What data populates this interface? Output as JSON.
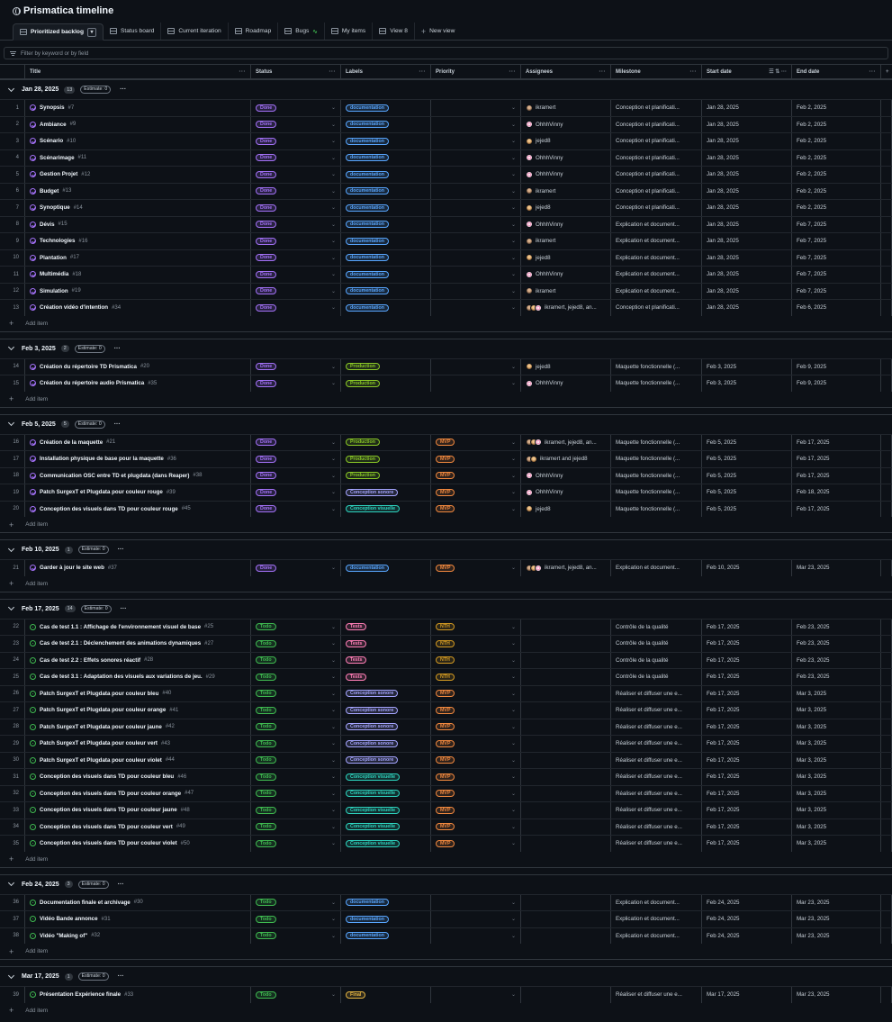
{
  "project": {
    "title": "Prismatica timeline"
  },
  "tabs": [
    {
      "label": "Prioritized backlog",
      "active": true
    },
    {
      "label": "Status board"
    },
    {
      "label": "Current iteration"
    },
    {
      "label": "Roadmap"
    },
    {
      "label": "Bugs"
    },
    {
      "label": "My items"
    },
    {
      "label": "View 8"
    },
    {
      "label": "New view"
    }
  ],
  "filter": {
    "placeholder": "Filter by keyword or by field"
  },
  "columns": [
    "Title",
    "Status",
    "Labels",
    "Priority",
    "Assignees",
    "Milestone",
    "Start date",
    "End date"
  ],
  "add_item_label": "Add item",
  "label_colors": {
    "documentation": "#58a6ff",
    "Production": "#8ac926",
    "Conception sonore": "#a5a5ff",
    "Conception visuelle": "#2dd4bf",
    "Tests": "#ff7eb6",
    "Final": "#e3b341"
  },
  "priority_colors": {
    "MVP": "#f0883e",
    "NTH": "#d29922"
  },
  "status_colors": {
    "Done": "#a371f7",
    "Todo": "#3fb950"
  },
  "groups": [
    {
      "title": "Jan 28, 2025",
      "count": "13",
      "estimate": "Estimate: 0",
      "rows": [
        {
          "n": "1",
          "title": "Synopsis",
          "num": "#7",
          "status": "Done",
          "label": "documentation",
          "priority": "",
          "av": [
            "k"
          ],
          "assignee": "ikramert",
          "milestone": "Conception et planificati...",
          "start": "Jan 28, 2025",
          "end": "Feb 2, 2025"
        },
        {
          "n": "2",
          "title": "Ambiance",
          "num": "#9",
          "status": "Done",
          "label": "documentation",
          "priority": "",
          "av": [
            "o"
          ],
          "assignee": "OhhhVinny",
          "milestone": "Conception et planificati...",
          "start": "Jan 28, 2025",
          "end": "Feb 2, 2025"
        },
        {
          "n": "3",
          "title": "Scénario",
          "num": "#10",
          "status": "Done",
          "label": "documentation",
          "priority": "",
          "av": [
            "j"
          ],
          "assignee": "jejed8",
          "milestone": "Conception et planificati...",
          "start": "Jan 28, 2025",
          "end": "Feb 2, 2025"
        },
        {
          "n": "4",
          "title": "Scénarimage",
          "num": "#11",
          "status": "Done",
          "label": "documentation",
          "priority": "",
          "av": [
            "o"
          ],
          "assignee": "OhhhVinny",
          "milestone": "Conception et planificati...",
          "start": "Jan 28, 2025",
          "end": "Feb 2, 2025"
        },
        {
          "n": "5",
          "title": "Gestion Projet",
          "num": "#12",
          "status": "Done",
          "label": "documentation",
          "priority": "",
          "av": [
            "o"
          ],
          "assignee": "OhhhVinny",
          "milestone": "Conception et planificati...",
          "start": "Jan 28, 2025",
          "end": "Feb 2, 2025"
        },
        {
          "n": "6",
          "title": "Budget",
          "num": "#13",
          "status": "Done",
          "label": "documentation",
          "priority": "",
          "av": [
            "k"
          ],
          "assignee": "ikramert",
          "milestone": "Conception et planificati...",
          "start": "Jan 28, 2025",
          "end": "Feb 2, 2025"
        },
        {
          "n": "7",
          "title": "Synoptique",
          "num": "#14",
          "status": "Done",
          "label": "documentation",
          "priority": "",
          "av": [
            "j"
          ],
          "assignee": "jejed8",
          "milestone": "Conception et planificati...",
          "start": "Jan 28, 2025",
          "end": "Feb 2, 2025"
        },
        {
          "n": "8",
          "title": "Dévis",
          "num": "#15",
          "status": "Done",
          "label": "documentation",
          "priority": "",
          "av": [
            "o"
          ],
          "assignee": "OhhhVinny",
          "milestone": "Explication et document...",
          "start": "Jan 28, 2025",
          "end": "Feb 7, 2025"
        },
        {
          "n": "9",
          "title": "Technologies",
          "num": "#16",
          "status": "Done",
          "label": "documentation",
          "priority": "",
          "av": [
            "k"
          ],
          "assignee": "ikramert",
          "milestone": "Explication et document...",
          "start": "Jan 28, 2025",
          "end": "Feb 7, 2025"
        },
        {
          "n": "10",
          "title": "Plantation",
          "num": "#17",
          "status": "Done",
          "label": "documentation",
          "priority": "",
          "av": [
            "j"
          ],
          "assignee": "jejed8",
          "milestone": "Explication et document...",
          "start": "Jan 28, 2025",
          "end": "Feb 7, 2025"
        },
        {
          "n": "11",
          "title": "Multimédia",
          "num": "#18",
          "status": "Done",
          "label": "documentation",
          "priority": "",
          "av": [
            "o"
          ],
          "assignee": "OhhhVinny",
          "milestone": "Explication et document...",
          "start": "Jan 28, 2025",
          "end": "Feb 7, 2025"
        },
        {
          "n": "12",
          "title": "Simulation",
          "num": "#19",
          "status": "Done",
          "label": "documentation",
          "priority": "",
          "av": [
            "k"
          ],
          "assignee": "ikramert",
          "milestone": "Explication et document...",
          "start": "Jan 28, 2025",
          "end": "Feb 7, 2025"
        },
        {
          "n": "13",
          "title": "Création vidéo d'intention",
          "num": "#34",
          "status": "Done",
          "label": "documentation",
          "priority": "",
          "av": [
            "k",
            "j",
            "o"
          ],
          "assignee": "ikramert, jejed8, an...",
          "milestone": "Conception et planificati...",
          "start": "Jan 28, 2025",
          "end": "Feb 6, 2025"
        }
      ]
    },
    {
      "title": "Feb 3, 2025",
      "count": "2",
      "estimate": "Estimate: 0",
      "rows": [
        {
          "n": "14",
          "title": "Création du répertoire TD Prismatica",
          "num": "#20",
          "status": "Done",
          "label": "Production",
          "priority": "",
          "av": [
            "j"
          ],
          "assignee": "jejed8",
          "milestone": "Maquette fonctionnelle (...",
          "start": "Feb 3, 2025",
          "end": "Feb 9, 2025"
        },
        {
          "n": "15",
          "title": "Création du répertoire audio Prismatica",
          "num": "#35",
          "status": "Done",
          "label": "Production",
          "priority": "",
          "av": [
            "o"
          ],
          "assignee": "OhhhVinny",
          "milestone": "Maquette fonctionnelle (...",
          "start": "Feb 3, 2025",
          "end": "Feb 9, 2025"
        }
      ]
    },
    {
      "title": "Feb 5, 2025",
      "count": "5",
      "estimate": "Estimate: 0",
      "rows": [
        {
          "n": "16",
          "title": "Création de la maquette",
          "num": "#21",
          "status": "Done",
          "label": "Production",
          "priority": "MVP",
          "av": [
            "k",
            "j",
            "o"
          ],
          "assignee": "ikramert, jejed8, an...",
          "milestone": "Maquette fonctionnelle (...",
          "start": "Feb 5, 2025",
          "end": "Feb 17, 2025"
        },
        {
          "n": "17",
          "title": "Installation physique de base pour la maquette",
          "num": "#36",
          "status": "Done",
          "label": "Production",
          "priority": "MVP",
          "av": [
            "k",
            "j"
          ],
          "assignee": "ikramert and jejed8",
          "milestone": "Maquette fonctionnelle (...",
          "start": "Feb 5, 2025",
          "end": "Feb 17, 2025"
        },
        {
          "n": "18",
          "title": "Communication OSC entre TD et plugdata (dans Reaper)",
          "num": "#38",
          "status": "Done",
          "label": "Production",
          "priority": "MVP",
          "av": [
            "o"
          ],
          "assignee": "OhhhVinny",
          "milestone": "Maquette fonctionnelle (...",
          "start": "Feb 5, 2025",
          "end": "Feb 17, 2025"
        },
        {
          "n": "19",
          "title": "Patch SurgexT et Plugdata pour couleur rouge",
          "num": "#39",
          "status": "Done",
          "label": "Conception sonore",
          "priority": "MVP",
          "av": [
            "o"
          ],
          "assignee": "OhhhVinny",
          "milestone": "Maquette fonctionnelle (...",
          "start": "Feb 5, 2025",
          "end": "Feb 18, 2025"
        },
        {
          "n": "20",
          "title": "Conception des visuels dans TD pour couleur rouge",
          "num": "#45",
          "status": "Done",
          "label": "Conception visuelle",
          "priority": "MVP",
          "av": [
            "j"
          ],
          "assignee": "jejed8",
          "milestone": "Maquette fonctionnelle (...",
          "start": "Feb 5, 2025",
          "end": "Feb 17, 2025"
        }
      ]
    },
    {
      "title": "Feb 10, 2025",
      "count": "1",
      "estimate": "Estimate: 0",
      "rows": [
        {
          "n": "21",
          "title": "Garder à jour le site web",
          "num": "#37",
          "status": "Done",
          "label": "documentation",
          "priority": "MVP",
          "av": [
            "k",
            "j",
            "o"
          ],
          "assignee": "ikramert, jejed8, an...",
          "milestone": "Explication et document...",
          "start": "Feb 10, 2025",
          "end": "Mar 23, 2025"
        }
      ]
    },
    {
      "title": "Feb 17, 2025",
      "count": "14",
      "estimate": "Estimate: 0",
      "rows": [
        {
          "n": "22",
          "title": "Cas de test 1.1 : Affichage de l'environnement visuel de base",
          "num": "#25",
          "status": "Todo",
          "label": "Tests",
          "priority": "NTH",
          "av": [],
          "assignee": "",
          "milestone": "Contrôle de la qualité",
          "start": "Feb 17, 2025",
          "end": "Feb 23, 2025"
        },
        {
          "n": "23",
          "title": "Cas de test 2.1 : Déclenchement des animations dynamiques",
          "num": "#27",
          "status": "Todo",
          "label": "Tests",
          "priority": "NTH",
          "av": [],
          "assignee": "",
          "milestone": "Contrôle de la qualité",
          "start": "Feb 17, 2025",
          "end": "Feb 23, 2025"
        },
        {
          "n": "24",
          "title": "Cas de test 2.2 : Effets sonores réactif",
          "num": "#28",
          "status": "Todo",
          "label": "Tests",
          "priority": "NTH",
          "av": [],
          "assignee": "",
          "milestone": "Contrôle de la qualité",
          "start": "Feb 17, 2025",
          "end": "Feb 23, 2025"
        },
        {
          "n": "25",
          "title": "Cas de test 3.1 : Adaptation des visuels aux variations de jeu.",
          "num": "#29",
          "status": "Todo",
          "label": "Tests",
          "priority": "NTH",
          "av": [],
          "assignee": "",
          "milestone": "Contrôle de la qualité",
          "start": "Feb 17, 2025",
          "end": "Feb 23, 2025"
        },
        {
          "n": "26",
          "title": "Patch SurgexT et Plugdata pour couleur bleu",
          "num": "#40",
          "status": "Todo",
          "label": "Conception sonore",
          "priority": "MVP",
          "av": [],
          "assignee": "",
          "milestone": "Réaliser et diffuser une e...",
          "start": "Feb 17, 2025",
          "end": "Mar 3, 2025"
        },
        {
          "n": "27",
          "title": "Patch SurgexT et Plugdata pour couleur orange",
          "num": "#41",
          "status": "Todo",
          "label": "Conception sonore",
          "priority": "MVP",
          "av": [],
          "assignee": "",
          "milestone": "Réaliser et diffuser une e...",
          "start": "Feb 17, 2025",
          "end": "Mar 3, 2025"
        },
        {
          "n": "28",
          "title": "Patch SurgexT et Plugdata pour couleur jaune",
          "num": "#42",
          "status": "Todo",
          "label": "Conception sonore",
          "priority": "MVP",
          "av": [],
          "assignee": "",
          "milestone": "Réaliser et diffuser une e...",
          "start": "Feb 17, 2025",
          "end": "Mar 3, 2025"
        },
        {
          "n": "29",
          "title": "Patch SurgexT et Plugdata pour couleur vert",
          "num": "#43",
          "status": "Todo",
          "label": "Conception sonore",
          "priority": "MVP",
          "av": [],
          "assignee": "",
          "milestone": "Réaliser et diffuser une e...",
          "start": "Feb 17, 2025",
          "end": "Mar 3, 2025"
        },
        {
          "n": "30",
          "title": "Patch SurgexT et Plugdata pour couleur violet",
          "num": "#44",
          "status": "Todo",
          "label": "Conception sonore",
          "priority": "MVP",
          "av": [],
          "assignee": "",
          "milestone": "Réaliser et diffuser une e...",
          "start": "Feb 17, 2025",
          "end": "Mar 3, 2025"
        },
        {
          "n": "31",
          "title": "Conception des visuels dans TD pour couleur bleu",
          "num": "#46",
          "status": "Todo",
          "label": "Conception visuelle",
          "priority": "MVP",
          "av": [],
          "assignee": "",
          "milestone": "Réaliser et diffuser une e...",
          "start": "Feb 17, 2025",
          "end": "Mar 3, 2025"
        },
        {
          "n": "32",
          "title": "Conception des visuels dans TD pour couleur orange",
          "num": "#47",
          "status": "Todo",
          "label": "Conception visuelle",
          "priority": "MVP",
          "av": [],
          "assignee": "",
          "milestone": "Réaliser et diffuser une e...",
          "start": "Feb 17, 2025",
          "end": "Mar 3, 2025"
        },
        {
          "n": "33",
          "title": "Conception des visuels dans TD pour couleur jaune",
          "num": "#48",
          "status": "Todo",
          "label": "Conception visuelle",
          "priority": "MVP",
          "av": [],
          "assignee": "",
          "milestone": "Réaliser et diffuser une e...",
          "start": "Feb 17, 2025",
          "end": "Mar 3, 2025"
        },
        {
          "n": "34",
          "title": "Conception des visuels dans TD pour couleur vert",
          "num": "#49",
          "status": "Todo",
          "label": "Conception visuelle",
          "priority": "MVP",
          "av": [],
          "assignee": "",
          "milestone": "Réaliser et diffuser une e...",
          "start": "Feb 17, 2025",
          "end": "Mar 3, 2025"
        },
        {
          "n": "35",
          "title": "Conception des visuels dans TD pour couleur violet",
          "num": "#50",
          "status": "Todo",
          "label": "Conception visuelle",
          "priority": "MVP",
          "av": [],
          "assignee": "",
          "milestone": "Réaliser et diffuser une e...",
          "start": "Feb 17, 2025",
          "end": "Mar 3, 2025"
        }
      ]
    },
    {
      "title": "Feb 24, 2025",
      "count": "3",
      "estimate": "Estimate: 0",
      "rows": [
        {
          "n": "36",
          "title": "Documentation finale et archivage",
          "num": "#30",
          "status": "Todo",
          "label": "documentation",
          "priority": "",
          "av": [],
          "assignee": "",
          "milestone": "Explication et document...",
          "start": "Feb 24, 2025",
          "end": "Mar 23, 2025"
        },
        {
          "n": "37",
          "title": "Vidéo Bande annonce",
          "num": "#31",
          "status": "Todo",
          "label": "documentation",
          "priority": "",
          "av": [],
          "assignee": "",
          "milestone": "Explication et document...",
          "start": "Feb 24, 2025",
          "end": "Mar 23, 2025"
        },
        {
          "n": "38",
          "title": "Vidéo \"Making of\"",
          "num": "#32",
          "status": "Todo",
          "label": "documentation",
          "priority": "",
          "av": [],
          "assignee": "",
          "milestone": "Explication et document...",
          "start": "Feb 24, 2025",
          "end": "Mar 23, 2025"
        }
      ]
    },
    {
      "title": "Mar 17, 2025",
      "count": "1",
      "estimate": "Estimate: 0",
      "rows": [
        {
          "n": "39",
          "title": "Présentation Expérience finale",
          "num": "#33",
          "status": "Todo",
          "label": "Final",
          "priority": "",
          "av": [],
          "assignee": "",
          "milestone": "Réaliser et diffuser une e...",
          "start": "Mar 17, 2025",
          "end": "Mar 23, 2025"
        }
      ]
    }
  ]
}
